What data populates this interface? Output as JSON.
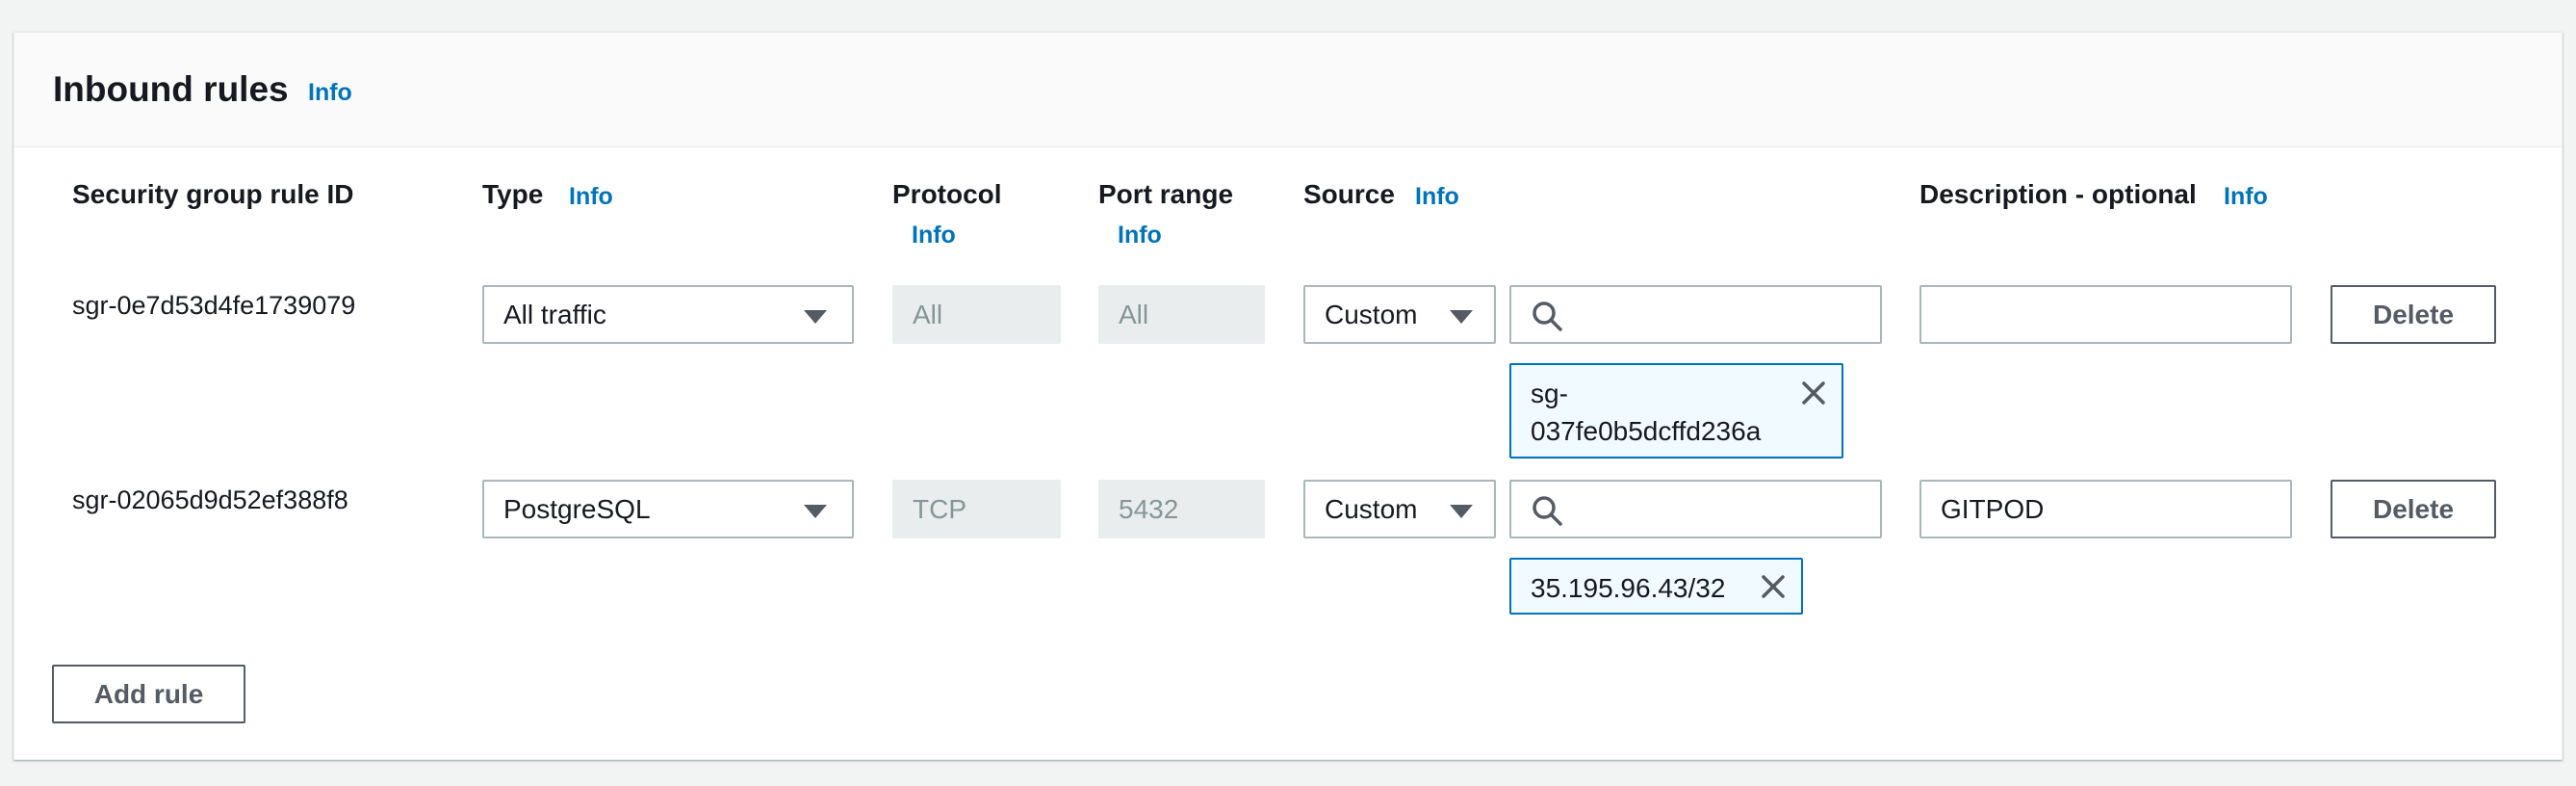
{
  "panel": {
    "title": "Inbound rules",
    "info": "Info"
  },
  "columns": {
    "rule_id": "Security group rule ID",
    "type": "Type",
    "type_info": "Info",
    "protocol": "Protocol",
    "protocol_info": "Info",
    "port_range": "Port range",
    "port_range_info": "Info",
    "source": "Source",
    "source_info": "Info",
    "description": "Description - optional",
    "description_info": "Info"
  },
  "rules": [
    {
      "id": "sgr-0e7d53d4fe1739079",
      "type": "All traffic",
      "protocol": "All",
      "port_range": "All",
      "source_type": "Custom",
      "source_search": "",
      "source_token_line1": "sg-",
      "source_token_line2": "037fe0b5dcffd236a",
      "description": "",
      "delete_label": "Delete"
    },
    {
      "id": "sgr-02065d9d52ef388f8",
      "type": "PostgreSQL",
      "protocol": "TCP",
      "port_range": "5432",
      "source_type": "Custom",
      "source_search": "",
      "source_token": "35.195.96.43/32",
      "description": "GITPOD",
      "delete_label": "Delete"
    }
  ],
  "add_rule_label": "Add rule",
  "icons": {
    "dropdown": "caret-down-icon",
    "search": "search-icon",
    "remove": "close-icon"
  },
  "colors": {
    "link": "#0073bb",
    "token_border": "#0073bb",
    "token_bg": "#f1faff",
    "disabled_bg": "#eaeded"
  }
}
